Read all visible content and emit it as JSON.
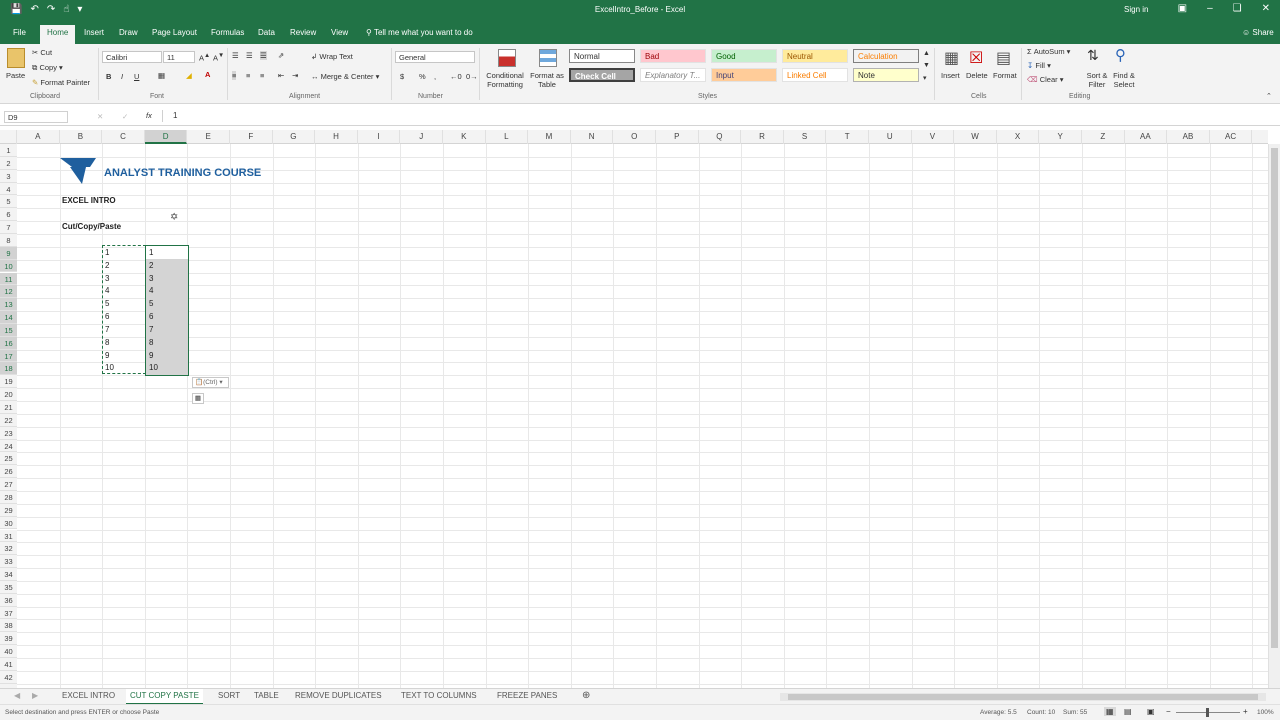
{
  "window": {
    "title": "ExcelIntro_Before  -  Excel",
    "signin": "Sign in",
    "share": "Share"
  },
  "tabs": [
    "File",
    "Home",
    "Insert",
    "Draw",
    "Page Layout",
    "Formulas",
    "Data",
    "Review",
    "View"
  ],
  "active_tab": "Home",
  "tell_me": "Tell me what you want to do",
  "ribbon": {
    "clipboard": {
      "paste": "Paste",
      "cut": "Cut",
      "copy": "Copy",
      "format_painter": "Format Painter",
      "group": "Clipboard"
    },
    "font": {
      "name": "Calibri",
      "size": "11",
      "bold": "B",
      "italic": "I",
      "underline": "U",
      "group": "Font"
    },
    "alignment": {
      "wrap": "Wrap Text",
      "merge": "Merge & Center",
      "group": "Alignment"
    },
    "number": {
      "format": "General",
      "currency": "$",
      "percent": "%",
      "comma": ",",
      "group": "Number"
    },
    "styles": {
      "conditional": "Conditional Formatting",
      "format_table": "Format as Table",
      "normal": "Normal",
      "bad": "Bad",
      "good": "Good",
      "neutral": "Neutral",
      "calculation": "Calculation",
      "check": "Check Cell",
      "explanatory": "Explanatory T...",
      "input": "Input",
      "linked": "Linked Cell",
      "note": "Note",
      "group": "Styles"
    },
    "cells": {
      "insert": "Insert",
      "delete": "Delete",
      "format": "Format",
      "group": "Cells"
    },
    "editing": {
      "autosum": "AutoSum",
      "fill": "Fill",
      "clear": "Clear",
      "sort": "Sort & Filter",
      "find": "Find & Select",
      "group": "Editing"
    }
  },
  "formula_bar": {
    "name_box": "D9",
    "fx": "fx",
    "value": "1"
  },
  "columns": [
    "A",
    "B",
    "C",
    "D",
    "E",
    "F",
    "G",
    "H",
    "I",
    "J",
    "K",
    "L",
    "M",
    "N",
    "O",
    "P",
    "Q",
    "R",
    "S",
    "T",
    "U",
    "V",
    "W",
    "X",
    "Y",
    "Z",
    "AA",
    "AB",
    "AC"
  ],
  "rows": [
    "1",
    "2",
    "3",
    "4",
    "5",
    "6",
    "7",
    "8",
    "9",
    "10",
    "11",
    "12",
    "13",
    "14",
    "15",
    "16",
    "17",
    "18",
    "19",
    "20",
    "21",
    "22",
    "23",
    "24",
    "25",
    "26",
    "27",
    "28",
    "29",
    "30",
    "31",
    "32",
    "33",
    "34",
    "35",
    "36",
    "37",
    "38",
    "39",
    "40",
    "41",
    "42",
    "43"
  ],
  "sheet": {
    "logo_text": "ANALYST TRAINING COURSE",
    "heading1": "EXCEL INTRO",
    "heading2": "Cut/Copy/Paste",
    "col_c": [
      "1",
      "2",
      "3",
      "4",
      "5",
      "6",
      "7",
      "8",
      "9",
      "10"
    ],
    "col_d": [
      "1",
      "2",
      "3",
      "4",
      "5",
      "6",
      "7",
      "8",
      "9",
      "10"
    ],
    "paste_options": "(Ctrl)"
  },
  "sheet_tabs": [
    "EXCEL INTRO",
    "CUT COPY PASTE",
    "SORT",
    "TABLE",
    "REMOVE DUPLICATES",
    "TEXT TO COLUMNS",
    "FREEZE PANES"
  ],
  "active_sheet": "CUT COPY PASTE",
  "status": {
    "message": "Select destination and press ENTER or choose Paste",
    "average": "Average: 5.5",
    "count": "Count: 10",
    "sum": "Sum: 55",
    "zoom": "100%"
  },
  "colors": {
    "excel_green": "#217346",
    "logo_blue": "#1f5f9e",
    "selection": "#d4d4d4"
  }
}
